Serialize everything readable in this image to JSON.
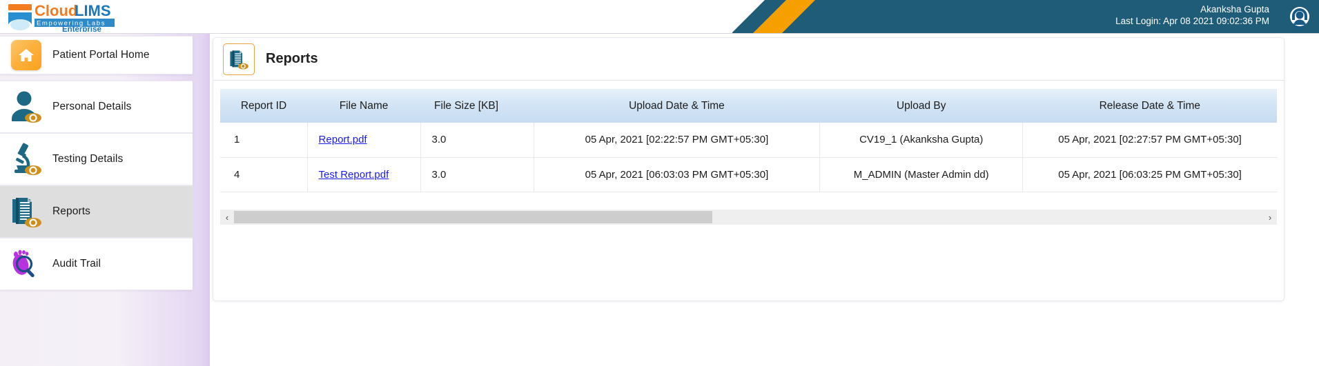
{
  "brand": {
    "name_cloud": "Cloud",
    "name_lims": "LIMS",
    "tagline": "Empowering Labs",
    "edition": "Enterprise",
    "color_orange": "#f47c20",
    "color_blue": "#1878be",
    "color_teal": "#1f5c78"
  },
  "header": {
    "user_name": "Akanksha Gupta",
    "last_login": "Last Login: Apr 08 2021 09:02:36 PM",
    "support_icon": "headset-icon",
    "accent_orange": "#f6a000",
    "bar_teal": "#1f5c78"
  },
  "sidebar": {
    "items": [
      {
        "label": "Patient Portal Home",
        "icon": "home-icon",
        "active": false
      },
      {
        "label": "Personal Details",
        "icon": "person-view-icon",
        "active": false
      },
      {
        "label": "Testing Details",
        "icon": "microscope-view-icon",
        "active": false
      },
      {
        "label": "Reports",
        "icon": "documents-view-icon",
        "active": true
      },
      {
        "label": "Audit Trail",
        "icon": "footprint-magnifier-icon",
        "active": false
      }
    ]
  },
  "panel": {
    "title": "Reports",
    "icon": "documents-view-icon"
  },
  "table": {
    "columns": [
      "Report ID",
      "File Name",
      "File Size [KB]",
      "Upload Date & Time",
      "Upload By",
      "Release Date & Time"
    ],
    "rows": [
      {
        "report_id": "1",
        "file_name": "Report.pdf",
        "file_size": "3.0",
        "upload_datetime": "05 Apr, 2021 [02:22:57 PM GMT+05:30]",
        "upload_by": "CV19_1 (Akanksha Gupta)",
        "release_datetime": "05 Apr, 2021 [02:27:57 PM GMT+05:30]"
      },
      {
        "report_id": "4",
        "file_name": "Test Report.pdf",
        "file_size": "3.0",
        "upload_datetime": "05 Apr, 2021 [06:03:03 PM GMT+05:30]",
        "upload_by": "M_ADMIN (Master Admin dd)",
        "release_datetime": "05 Apr, 2021 [06:03:25 PM GMT+05:30]"
      }
    ]
  },
  "scrollbar": {
    "left_arrow": "‹",
    "right_arrow": "›"
  }
}
